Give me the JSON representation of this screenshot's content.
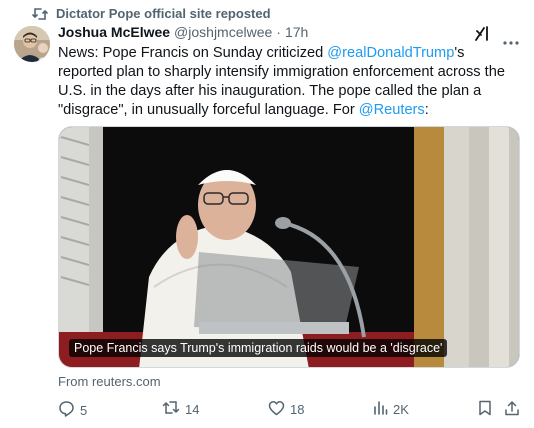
{
  "repost": {
    "label": "Dictator Pope official site reposted",
    "icon": "repost-icon"
  },
  "tweet": {
    "author_name": "Joshua McElwee",
    "author_handle": "@joshjmcelwee",
    "separator": "·",
    "time": "17h",
    "text_part1": "News: Pope Francis on Sunday criticized ",
    "mention_1": "@realDonaldTrump",
    "text_part2": "'s reported plan to sharply intensify immigration enforcement across the U.S. in the days after his inauguration. The pope called the plan a \"disgrace\", in unusually forceful language. For ",
    "mention_2": "@Reuters",
    "text_part3": ":"
  },
  "media": {
    "caption": "Pope Francis says Trump's immigration raids would be a 'disgrace'",
    "source": "From reuters.com"
  },
  "actions": {
    "replies": "5",
    "reposts": "14",
    "likes": "18",
    "views": "2K"
  },
  "colors": {
    "link": "#1d9bf0",
    "secondary_text": "#536471",
    "primary_text": "#0f1419"
  }
}
